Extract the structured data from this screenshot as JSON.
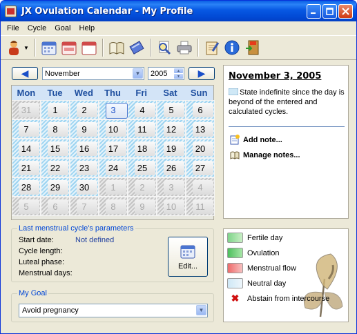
{
  "window": {
    "title": "JX Ovulation Calendar - My Profile"
  },
  "menu": [
    "File",
    "Cycle",
    "Goal",
    "Help"
  ],
  "toolbar_icons": [
    "profile-user-icon",
    "calendar-month-icon",
    "calendar-week-icon",
    "calendar-day-icon",
    "open-book-icon",
    "notebook-icon",
    "print-preview-icon",
    "printer-icon",
    "edit-note-icon",
    "info-icon",
    "exit-door-icon"
  ],
  "nav": {
    "month": "November",
    "year": "2005",
    "prev": "◀",
    "next": "▶"
  },
  "calendar": {
    "days_of_week": [
      "Mon",
      "Tue",
      "Wed",
      "Thu",
      "Fri",
      "Sat",
      "Sun"
    ],
    "weeks": [
      [
        {
          "d": "31",
          "o": true
        },
        {
          "d": "1"
        },
        {
          "d": "2"
        },
        {
          "d": "3",
          "t": true
        },
        {
          "d": "4"
        },
        {
          "d": "5"
        },
        {
          "d": "6"
        }
      ],
      [
        {
          "d": "7"
        },
        {
          "d": "8"
        },
        {
          "d": "9"
        },
        {
          "d": "10"
        },
        {
          "d": "11"
        },
        {
          "d": "12"
        },
        {
          "d": "13"
        }
      ],
      [
        {
          "d": "14"
        },
        {
          "d": "15"
        },
        {
          "d": "16"
        },
        {
          "d": "17"
        },
        {
          "d": "18"
        },
        {
          "d": "19"
        },
        {
          "d": "20"
        }
      ],
      [
        {
          "d": "21"
        },
        {
          "d": "22"
        },
        {
          "d": "23"
        },
        {
          "d": "24"
        },
        {
          "d": "25"
        },
        {
          "d": "26"
        },
        {
          "d": "27"
        }
      ],
      [
        {
          "d": "28"
        },
        {
          "d": "29"
        },
        {
          "d": "30"
        },
        {
          "d": "1",
          "o": true
        },
        {
          "d": "2",
          "o": true
        },
        {
          "d": "3",
          "o": true
        },
        {
          "d": "4",
          "o": true
        }
      ],
      [
        {
          "d": "5",
          "o": true
        },
        {
          "d": "6",
          "o": true
        },
        {
          "d": "7",
          "o": true
        },
        {
          "d": "8",
          "o": true
        },
        {
          "d": "9",
          "o": true
        },
        {
          "d": "10",
          "o": true
        },
        {
          "d": "11",
          "o": true
        }
      ]
    ]
  },
  "params": {
    "title": "Last menstrual cycle's parameters",
    "start_label": "Start date:",
    "start_value": "Not defined",
    "cycle_label": "Cycle length:",
    "luteal_label": "Luteal phase:",
    "menstrual_label": "Menstrual days:",
    "edit_label": "Edit..."
  },
  "goal": {
    "title": "My Goal",
    "value": "Avoid pregnancy"
  },
  "info": {
    "date": "November 3, 2005",
    "text": "State indefinite since the day is beyond of the entered and calculated cycles.",
    "add_note": "Add note...",
    "manage_notes": "Manage notes..."
  },
  "legend": [
    "Fertile day",
    "Ovulation",
    "Menstrual flow",
    "Neutral day",
    "Abstain from intercourse"
  ]
}
